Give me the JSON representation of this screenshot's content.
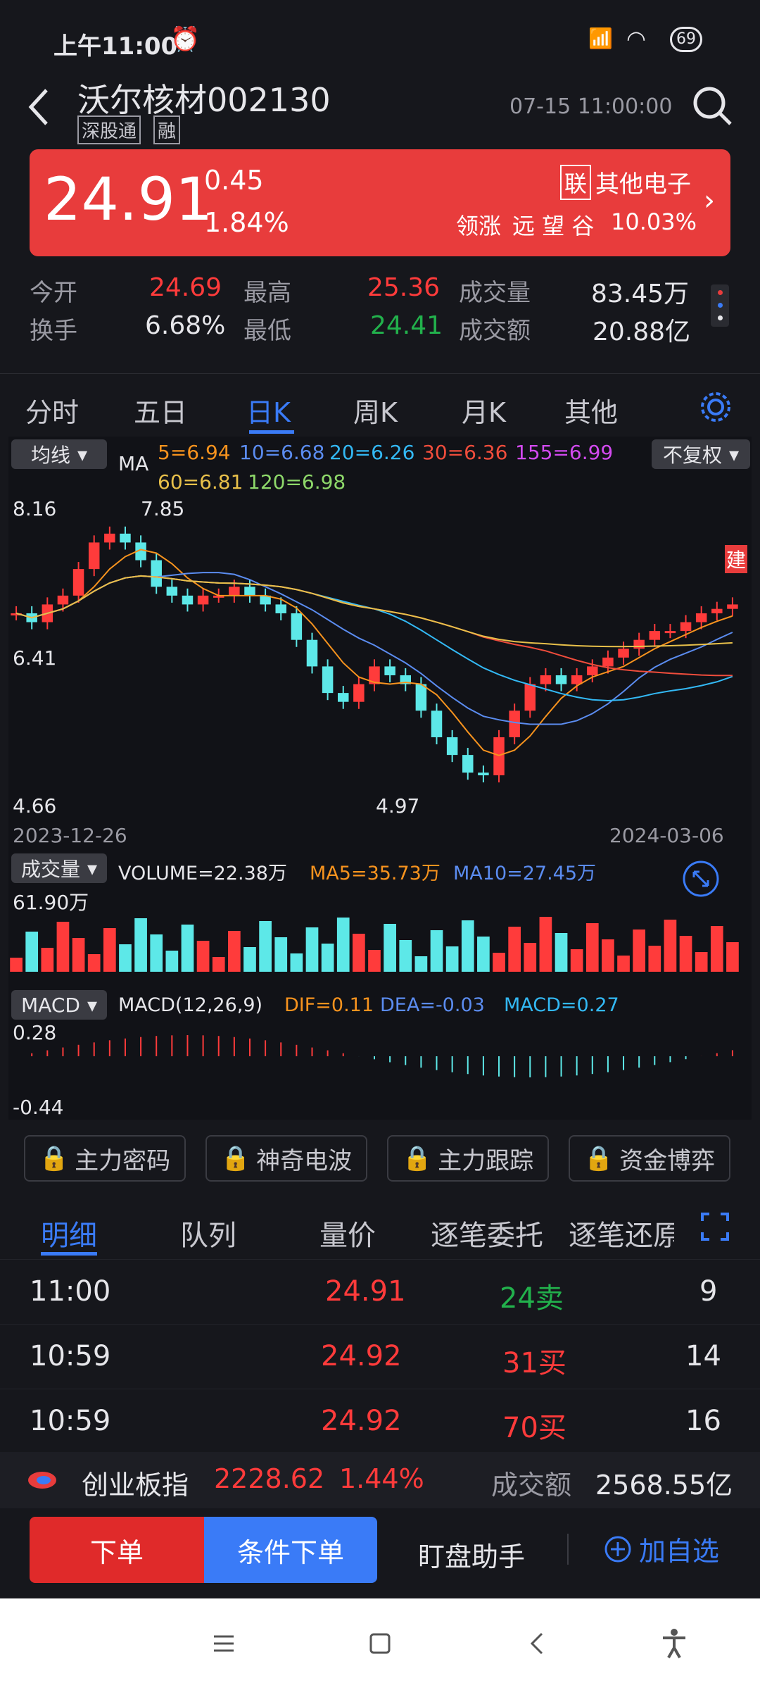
{
  "status": {
    "time": "上午11:00",
    "battery": "69"
  },
  "header": {
    "title": "沃尔核材002130",
    "tag1": "深股通",
    "tag2": "融",
    "datetime": "07-15 11:00:00"
  },
  "quote": {
    "price": "24.91",
    "change": "0.45",
    "pct": "1.84%",
    "sector_badge": "联",
    "sector": "其他电子",
    "leader_label": "领涨",
    "leader": "远 望 谷",
    "leader_pct": "10.03%"
  },
  "stats": {
    "open_label": "今开",
    "open": "24.69",
    "high_label": "最高",
    "high": "25.36",
    "vol_label": "成交量",
    "vol": "83.45万",
    "turn_label": "换手",
    "turn": "6.68%",
    "low_label": "最低",
    "low": "24.41",
    "amt_label": "成交额",
    "amt": "20.88亿"
  },
  "tabs": [
    "分时",
    "五日",
    "日K",
    "周K",
    "月K",
    "其他"
  ],
  "active_tab": "日K",
  "chart_header": {
    "ma_dropdown": "均线",
    "ma_label": "MA",
    "ma5": "5=6.94",
    "ma10": "10=6.68",
    "ma20": "20=6.26",
    "ma30": "30=6.36",
    "ma155": "155=6.99",
    "ma60": "60=6.81",
    "ma120": "120=6.98",
    "adjust": "不复权",
    "build": "建"
  },
  "chart_axis": {
    "ymax": "8.16",
    "ymid": "6.41",
    "ymin": "4.66",
    "hi_note": "7.85",
    "lo_note": "4.97",
    "date_start": "2023-12-26",
    "date_end": "2024-03-06"
  },
  "volume": {
    "dropdown": "成交量",
    "label": "VOLUME=22.38万",
    "ma5": "MA5=35.73万",
    "ma10": "MA10=27.45万",
    "max": "61.90万"
  },
  "macd": {
    "dropdown": "MACD",
    "label": "MACD(12,26,9)",
    "dif": "DIF=0.11",
    "dea": "DEA=-0.03",
    "macd": "MACD=0.27",
    "ymax": "0.28",
    "ymin": "-0.44"
  },
  "tools": [
    "主力密码",
    "神奇电波",
    "主力跟踪",
    "资金博弈"
  ],
  "subtabs": [
    "明细",
    "队列",
    "量价",
    "逐笔委托",
    "逐笔还原"
  ],
  "trades": [
    {
      "time": "11:00",
      "price": "24.91",
      "vol": "24卖",
      "n": "9"
    },
    {
      "time": "10:59",
      "price": "24.92",
      "vol": "31买",
      "n": "14"
    },
    {
      "time": "10:59",
      "price": "24.92",
      "vol": "70买",
      "n": "16"
    }
  ],
  "index": {
    "name": "创业板指",
    "value": "2228.62",
    "pct": "1.44%",
    "amt_label": "成交额",
    "amt": "2568.55亿"
  },
  "bottom": {
    "order": "下单",
    "cond_order": "条件下单",
    "helper": "盯盘助手",
    "watch": "加自选"
  },
  "colors": {
    "up": "#ff3b3b",
    "down": "#5de8e8",
    "price_bg": "#e83c3c",
    "accent": "#3a7bf7"
  }
}
